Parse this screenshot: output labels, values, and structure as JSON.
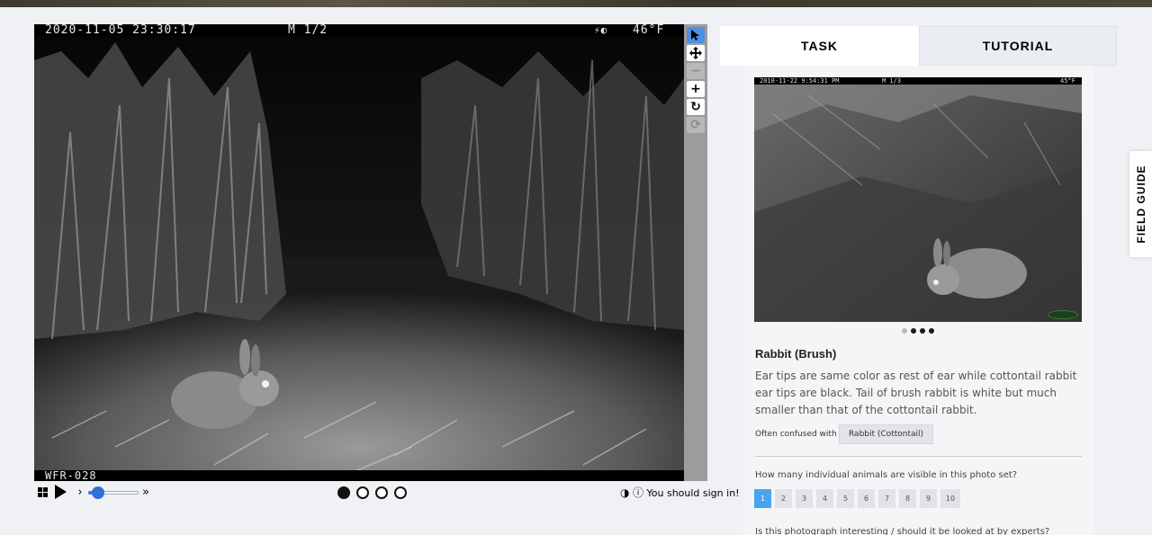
{
  "subject": {
    "camera_timestamp": "2020-11-05 23:30:17",
    "camera_mode": "M 1/2",
    "camera_moon_icon": "moon-phase-icon",
    "camera_temperature": "46°F",
    "camera_id": "WFR-028"
  },
  "toolbar": {
    "tools": [
      {
        "name": "pointer",
        "icon": "cursor-arrow-icon",
        "active": true
      },
      {
        "name": "move",
        "icon": "move-arrows-icon",
        "active": false
      },
      {
        "name": "zoom-out",
        "icon": "minus-icon",
        "disabled": true
      },
      {
        "name": "zoom-in",
        "icon": "plus-icon",
        "active": false
      },
      {
        "name": "rotate",
        "icon": "rotate-icon",
        "active": false
      },
      {
        "name": "reset",
        "icon": "reset-icon",
        "disabled": true
      }
    ]
  },
  "controls": {
    "frames": 4,
    "current_frame": 1,
    "speed_level": 0.2,
    "signin_text": "You should sign in!"
  },
  "panel": {
    "tabs": {
      "task": "TASK",
      "tutorial": "TUTORIAL"
    },
    "example": {
      "timestamp": "2010-11-22 9:54:31 PM",
      "mode": "M 1/3",
      "temperature": "45°F",
      "dots_total": 4,
      "dot_active": 1
    },
    "species_name": "Rabbit (Brush)",
    "species_description": "Ear tips are same color as rest of ear while cottontail rabbit ear tips are black. Tail of brush rabbit is white but much smaller than that of the cottontail rabbit.",
    "confused_label": "Often confused with",
    "confused_with": "Rabbit (Cottontail)",
    "question_count": "How many individual animals are visible in this photo set?",
    "count_options": [
      "1",
      "2",
      "3",
      "4",
      "5",
      "6",
      "7",
      "8",
      "9",
      "10"
    ],
    "count_selected": "1",
    "question_interesting": "Is this photograph interesting / should it be looked at by experts?"
  },
  "field_guide_label": "FIELD GUIDE",
  "colors": {
    "accent": "#4aa3ee",
    "toolbar_active": "#4f8fe0",
    "page_bg": "#eff1f4"
  }
}
